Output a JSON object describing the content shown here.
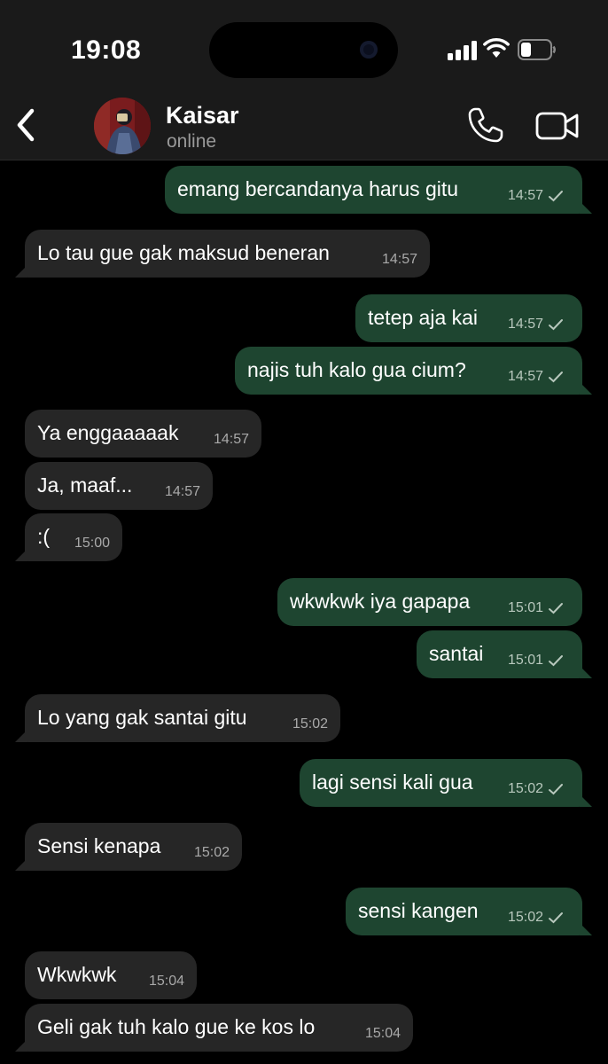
{
  "status_bar": {
    "time": "19:08"
  },
  "header": {
    "contact_name": "Kaisar",
    "contact_status": "online"
  },
  "messages": [
    {
      "dir": "out",
      "text": "emang bercandanya harus gitu",
      "time": "14:57",
      "status": "sent"
    },
    {
      "dir": "in",
      "text": "Lo tau gue gak maksud beneran",
      "time": "14:57"
    },
    {
      "dir": "out",
      "text": "tetep aja kai",
      "time": "14:57",
      "status": "sent"
    },
    {
      "dir": "out",
      "text": "najis tuh kalo gua cium?",
      "time": "14:57",
      "status": "sent"
    },
    {
      "dir": "in",
      "text": "Ya enggaaaaak",
      "time": "14:57"
    },
    {
      "dir": "in",
      "text": "Ja, maaf...",
      "time": "14:57"
    },
    {
      "dir": "in",
      "text": ":(",
      "time": "15:00"
    },
    {
      "dir": "out",
      "text": "wkwkwk iya gapapa",
      "time": "15:01",
      "status": "sent"
    },
    {
      "dir": "out",
      "text": "santai",
      "time": "15:01",
      "status": "sent"
    },
    {
      "dir": "in",
      "text": "Lo yang gak santai gitu",
      "time": "15:02"
    },
    {
      "dir": "out",
      "text": "lagi sensi kali gua",
      "time": "15:02",
      "status": "sent"
    },
    {
      "dir": "in",
      "text": "Sensi kenapa",
      "time": "15:02"
    },
    {
      "dir": "out",
      "text": "sensi kangen",
      "time": "15:02",
      "status": "sent"
    },
    {
      "dir": "in",
      "text": "Wkwkwk",
      "time": "15:04"
    },
    {
      "dir": "in",
      "text": "Geli gak tuh kalo gue ke kos lo",
      "time": "15:04"
    }
  ],
  "icons": {
    "back": "chevron-left-icon",
    "call": "phone-icon",
    "video": "video-camera-icon",
    "read_status": "checkmark-icon"
  },
  "colors": {
    "background": "#000000",
    "header": "#1a1a1a",
    "incoming_bubble": "#262626",
    "outgoing_bubble": "#1e4530",
    "timestamp": "#a9a9a9"
  }
}
